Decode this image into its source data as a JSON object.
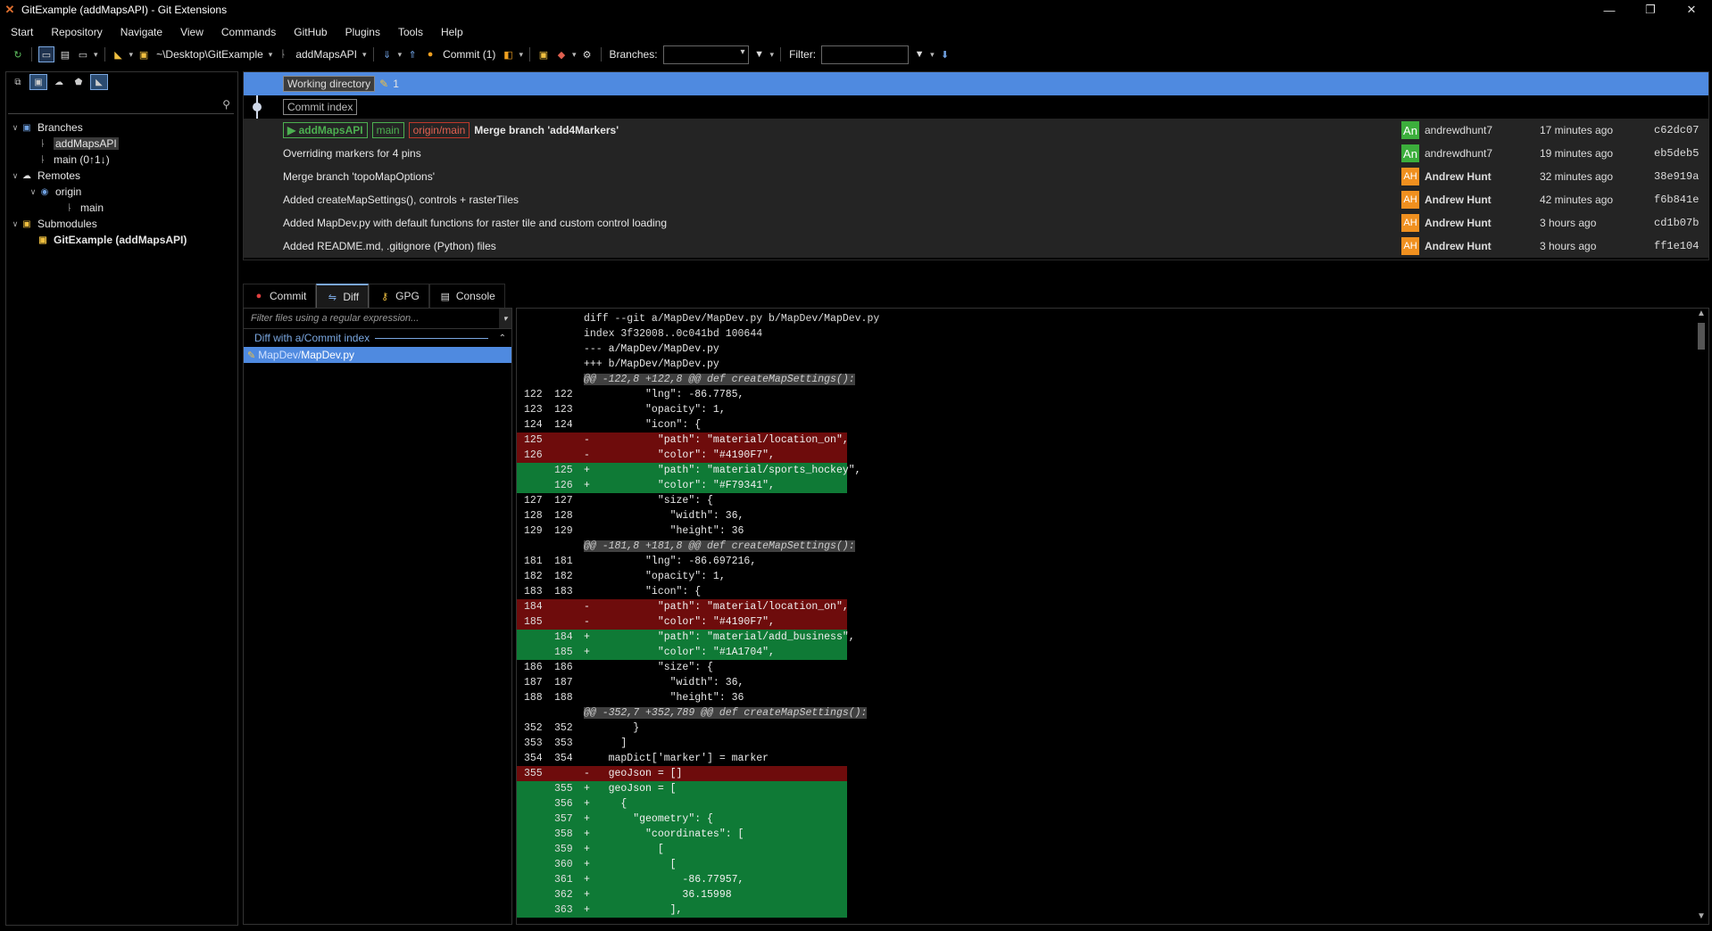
{
  "window": {
    "title": "GitExample (addMapsAPI) - Git Extensions",
    "controls": {
      "minimize": "—",
      "restore": "❐",
      "close": "✕"
    }
  },
  "menu": [
    "Start",
    "Repository",
    "Navigate",
    "View",
    "Commands",
    "GitHub",
    "Plugins",
    "Tools",
    "Help"
  ],
  "toolbar": {
    "repo_path": "~\\Desktop\\GitExample",
    "branch": "addMapsAPI",
    "commit_label": "Commit (1)",
    "branches_label": "Branches:",
    "branches_value": "",
    "filter_label": "Filter:",
    "filter_value": ""
  },
  "left_panel": {
    "search_value": "",
    "tree": {
      "branches": "Branches",
      "branch_items": [
        "addMapsAPI",
        "main (0↑1↓)"
      ],
      "remotes": "Remotes",
      "origin": "origin",
      "origin_main": "main",
      "submodules": "Submodules",
      "submodule_item": "GitExample (addMapsAPI)"
    }
  },
  "graph": {
    "working_directory": "Working directory",
    "working_count": "1",
    "commit_index": "Commit index",
    "commits": [
      {
        "refs": [
          "addMapsAPI",
          "main",
          "origin/main"
        ],
        "message": "Merge branch 'add4Markers'",
        "avatar": "An",
        "author": "andrewdhunt7",
        "date": "17 minutes ago",
        "hash": "c62dc07"
      },
      {
        "refs": [],
        "message": "Overriding markers for 4 pins",
        "avatar": "An",
        "author": "andrewdhunt7",
        "date": "19 minutes ago",
        "hash": "eb5deb5"
      },
      {
        "refs": [],
        "message": "Merge branch 'topoMapOptions'",
        "avatar": "AH",
        "author": "Andrew Hunt",
        "date": "32 minutes ago",
        "hash": "38e919a"
      },
      {
        "refs": [],
        "message": "Added createMapSettings(), controls + rasterTiles",
        "avatar": "AH",
        "author": "Andrew Hunt",
        "date": "42 minutes ago",
        "hash": "f6b841e"
      },
      {
        "refs": [],
        "message": "Added MapDev.py with default functions for raster tile and custom control loading",
        "avatar": "AH",
        "author": "Andrew Hunt",
        "date": "3 hours ago",
        "hash": "cd1b07b"
      },
      {
        "refs": [],
        "message": "Added README.md, .gitignore (Python) files",
        "avatar": "AH",
        "author": "Andrew Hunt",
        "date": "3 hours ago",
        "hash": "ff1e104"
      }
    ]
  },
  "bottom_tabs": [
    "Commit",
    "Diff",
    "GPG",
    "Console"
  ],
  "files": {
    "filter_placeholder": "Filter files using a regular expression...",
    "group_label": "Diff with a/Commit index",
    "file_dir": "MapDev/",
    "file_name": "MapDev.py"
  },
  "diff": {
    "lines": [
      {
        "t": "hdr",
        "n1": "",
        "n2": "",
        "code": "diff --git a/MapDev/MapDev.py b/MapDev/MapDev.py"
      },
      {
        "t": "idx",
        "n1": "",
        "n2": "",
        "code": "index 3f32008..0c041bd 100644"
      },
      {
        "t": "minus",
        "n1": "",
        "n2": "",
        "code": "--- a/MapDev/MapDev.py"
      },
      {
        "t": "plus",
        "n1": "",
        "n2": "",
        "code": "+++ b/MapDev/MapDev.py"
      },
      {
        "t": "hunk",
        "n1": "",
        "n2": "",
        "code": "@@ -122,8 +122,8 @@ def createMapSettings():"
      },
      {
        "t": "ctx",
        "n1": "122",
        "n2": "122",
        "code": "          \"lng\": -86.7785,"
      },
      {
        "t": "ctx",
        "n1": "123",
        "n2": "123",
        "code": "          \"opacity\": 1,"
      },
      {
        "t": "ctx",
        "n1": "124",
        "n2": "124",
        "code": "          \"icon\": {"
      },
      {
        "t": "del",
        "n1": "125",
        "n2": "",
        "code": "-           \"path\": \"material/location_on\","
      },
      {
        "t": "del",
        "n1": "126",
        "n2": "",
        "code": "-           \"color\": \"#4190F7\","
      },
      {
        "t": "add",
        "n1": "",
        "n2": "125",
        "code": "+           \"path\": \"material/sports_hockey\","
      },
      {
        "t": "add",
        "n1": "",
        "n2": "126",
        "code": "+           \"color\": \"#F79341\","
      },
      {
        "t": "ctx",
        "n1": "127",
        "n2": "127",
        "code": "            \"size\": {"
      },
      {
        "t": "ctx",
        "n1": "128",
        "n2": "128",
        "code": "              \"width\": 36,"
      },
      {
        "t": "ctx",
        "n1": "129",
        "n2": "129",
        "code": "              \"height\": 36"
      },
      {
        "t": "hunk",
        "n1": "",
        "n2": "",
        "code": "@@ -181,8 +181,8 @@ def createMapSettings():"
      },
      {
        "t": "ctx",
        "n1": "181",
        "n2": "181",
        "code": "          \"lng\": -86.697216,"
      },
      {
        "t": "ctx",
        "n1": "182",
        "n2": "182",
        "code": "          \"opacity\": 1,"
      },
      {
        "t": "ctx",
        "n1": "183",
        "n2": "183",
        "code": "          \"icon\": {"
      },
      {
        "t": "del",
        "n1": "184",
        "n2": "",
        "code": "-           \"path\": \"material/location_on\","
      },
      {
        "t": "del",
        "n1": "185",
        "n2": "",
        "code": "-           \"color\": \"#4190F7\","
      },
      {
        "t": "add",
        "n1": "",
        "n2": "184",
        "code": "+           \"path\": \"material/add_business\","
      },
      {
        "t": "add",
        "n1": "",
        "n2": "185",
        "code": "+           \"color\": \"#1A1704\","
      },
      {
        "t": "ctx",
        "n1": "186",
        "n2": "186",
        "code": "            \"size\": {"
      },
      {
        "t": "ctx",
        "n1": "187",
        "n2": "187",
        "code": "              \"width\": 36,"
      },
      {
        "t": "ctx",
        "n1": "188",
        "n2": "188",
        "code": "              \"height\": 36"
      },
      {
        "t": "hunk",
        "n1": "",
        "n2": "",
        "code": "@@ -352,7 +352,789 @@ def createMapSettings():"
      },
      {
        "t": "ctx",
        "n1": "352",
        "n2": "352",
        "code": "        }"
      },
      {
        "t": "ctx",
        "n1": "353",
        "n2": "353",
        "code": "      ]"
      },
      {
        "t": "ctx",
        "n1": "354",
        "n2": "354",
        "code": "    mapDict['marker'] = marker"
      },
      {
        "t": "del",
        "n1": "355",
        "n2": "",
        "code": "-   geoJson = []"
      },
      {
        "t": "add",
        "n1": "",
        "n2": "355",
        "code": "+   geoJson = ["
      },
      {
        "t": "add",
        "n1": "",
        "n2": "356",
        "code": "+     {"
      },
      {
        "t": "add",
        "n1": "",
        "n2": "357",
        "code": "+       \"geometry\": {"
      },
      {
        "t": "add",
        "n1": "",
        "n2": "358",
        "code": "+         \"coordinates\": ["
      },
      {
        "t": "add",
        "n1": "",
        "n2": "359",
        "code": "+           ["
      },
      {
        "t": "add",
        "n1": "",
        "n2": "360",
        "code": "+             ["
      },
      {
        "t": "add",
        "n1": "",
        "n2": "361",
        "code": "+               -86.77957,"
      },
      {
        "t": "add",
        "n1": "",
        "n2": "362",
        "code": "+               36.15998"
      },
      {
        "t": "add",
        "n1": "",
        "n2": "363",
        "code": "+             ],"
      }
    ]
  },
  "colors": {
    "selection": "#4f8ae0",
    "added": "#0f7a36",
    "removed": "#6e0c0c",
    "graph_blue": "#7fb0e8",
    "graph_orange": "#f0a020",
    "graph_red": "#e04030"
  }
}
